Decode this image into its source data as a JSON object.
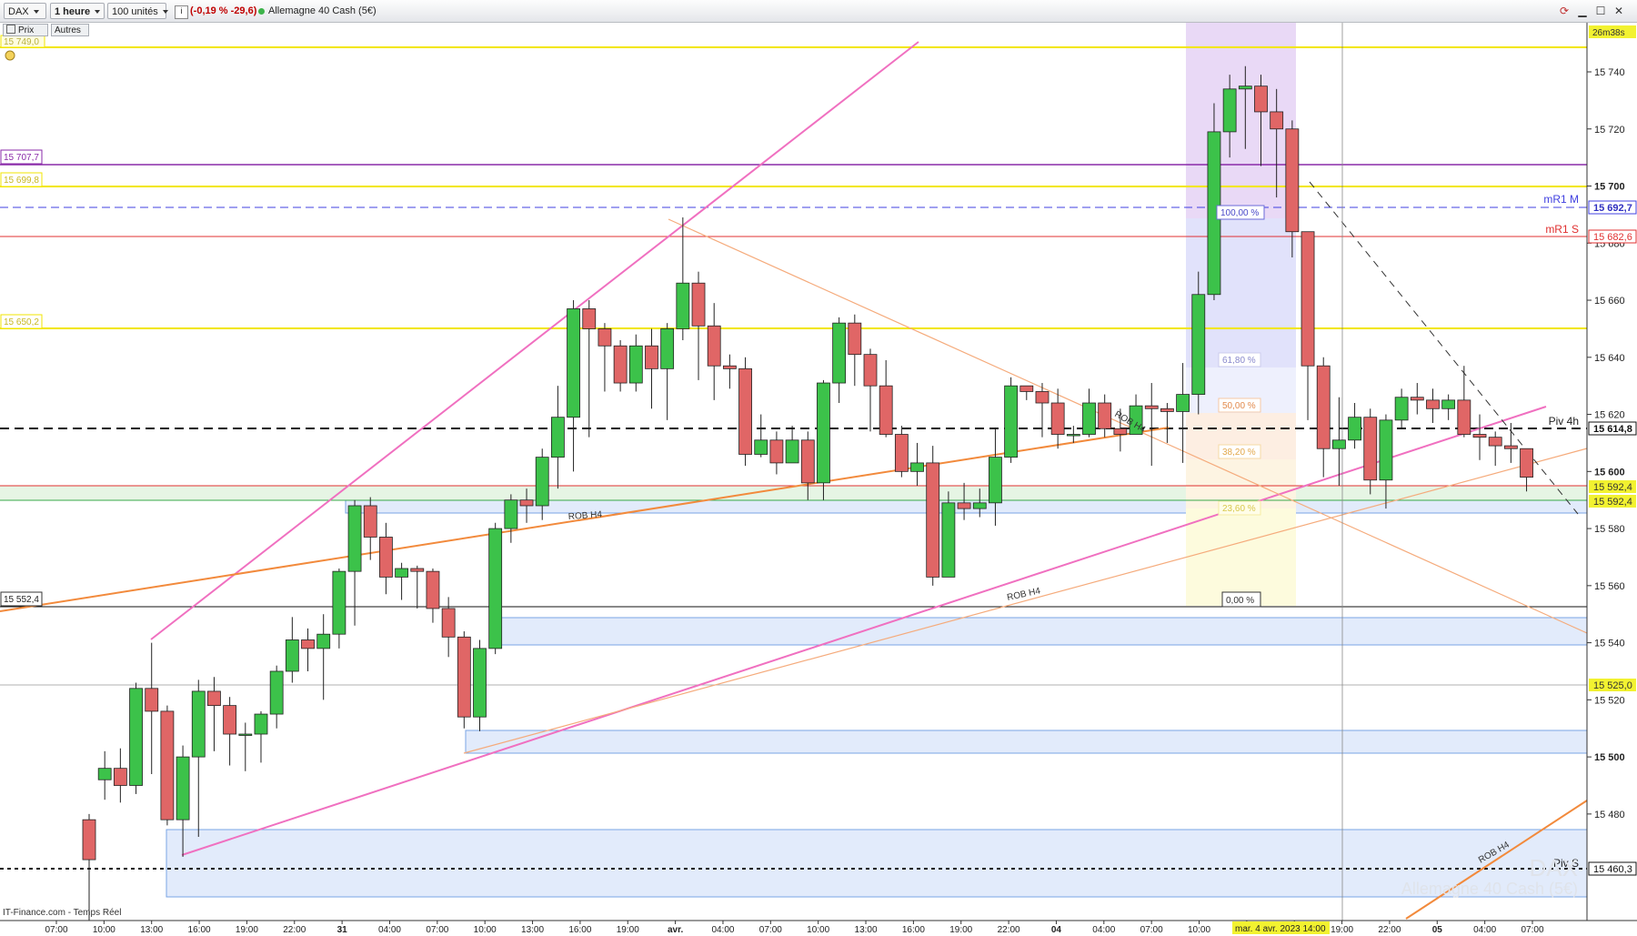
{
  "toolbar": {
    "symbol": "DAX",
    "timeframe": "1 heure",
    "units": "100 unités",
    "change": "(-0,19 % -29,6)",
    "instrument": "Allemagne 40 Cash (5€)"
  },
  "subbar": {
    "price_label": "Prix",
    "others_label": "Autres"
  },
  "timer": "26m38s",
  "footer": {
    "source": "IT-Finance.com - Temps Réel",
    "watermark_symbol": "DAX",
    "watermark_name": "Allemagne 40 Cash (5€)"
  },
  "colors": {
    "up": "#3cc24a",
    "down": "#e06666",
    "yellow": "#f2e600",
    "purple": "#8a2aa8",
    "blue_dash": "#4040e0",
    "red": "#e03030",
    "pink": "#f070c0",
    "orange": "#f28a3c",
    "zone_blue": "#e2ebfb"
  },
  "left_labels": {
    "l1": "15 749,0",
    "l2": "15 707,7",
    "l3": "15 699,8",
    "l4": "15 650,2",
    "l5": "15 552,4"
  },
  "right_labels": {
    "r1": "15 692,7",
    "r2": "15 682,6",
    "r3": "15 614,8",
    "r4": "15 592,4",
    "r5": "15 592,4",
    "r6": "15 525,0",
    "r7": "15 460,3"
  },
  "line_names": {
    "mr1m": "mR1 M",
    "mr1s": "mR1 S",
    "piv4h": "Piv 4h",
    "pivs": "Piv S"
  },
  "fib": {
    "f100": "100,00 %",
    "f618": "61,80 %",
    "f50": "50,00 %",
    "f382": "38,20 %",
    "f236": "23,60 %",
    "f0": "0,00 %"
  },
  "rob": {
    "a": "ROB H4",
    "b": "ROB H4",
    "c": "ROB H4",
    "d": "ROB H4"
  },
  "crosshair_label": "mar. 4 avr. 2023 14:00",
  "chart_data": {
    "type": "candlestick",
    "y_ticks": [
      "15 740",
      "15 720",
      "15 700",
      "15 680",
      "15 660",
      "15 640",
      "15 620",
      "15 600",
      "15 580",
      "15 560",
      "15 540",
      "15 520",
      "15 500",
      "15 480"
    ],
    "x_ticks": [
      "07:00",
      "10:00",
      "13:00",
      "16:00",
      "19:00",
      "22:00",
      "31",
      "04:00",
      "07:00",
      "10:00",
      "13:00",
      "16:00",
      "19:00",
      "avr.",
      "04:00",
      "07:00",
      "10:00",
      "13:00",
      "16:00",
      "19:00",
      "22:00",
      "04",
      "04:00",
      "07:00",
      "10:00",
      "13:00",
      "16:00",
      "19:00",
      "22:00",
      "05",
      "04:00",
      "07:00"
    ],
    "ylim": [
      15450,
      15760
    ],
    "candles": [
      [
        15478,
        15464,
        15480,
        15442
      ],
      [
        15492,
        15496,
        15502,
        15485
      ],
      [
        15496,
        15490,
        15503,
        15484
      ],
      [
        15490,
        15524,
        15526,
        15487
      ],
      [
        15524,
        15516,
        15540,
        15494
      ],
      [
        15516,
        15478,
        15518,
        15476
      ],
      [
        15478,
        15500,
        15504,
        15465
      ],
      [
        15500,
        15523,
        15527,
        15472
      ],
      [
        15523,
        15518,
        15528,
        15502
      ],
      [
        15518,
        15508,
        15521,
        15497
      ],
      [
        15508,
        15508,
        15512,
        15495
      ],
      [
        15508,
        15515,
        15516,
        15498
      ],
      [
        15515,
        15530,
        15532,
        15510
      ],
      [
        15530,
        15541,
        15549,
        15526
      ],
      [
        15541,
        15538,
        15545,
        15530
      ],
      [
        15538,
        15543,
        15550,
        15520
      ],
      [
        15543,
        15565,
        15566,
        15538
      ],
      [
        15565,
        15588,
        15590,
        15546
      ],
      [
        15588,
        15577,
        15591,
        15569
      ],
      [
        15577,
        15563,
        15582,
        15557
      ],
      [
        15563,
        15566,
        15568,
        15555
      ],
      [
        15566,
        15565,
        15567,
        15552
      ],
      [
        15565,
        15552,
        15566,
        15547
      ],
      [
        15552,
        15542,
        15556,
        15535
      ],
      [
        15542,
        15514,
        15544,
        15510
      ],
      [
        15514,
        15538,
        15541,
        15509
      ],
      [
        15538,
        15580,
        15582,
        15536
      ],
      [
        15580,
        15590,
        15592,
        15575
      ],
      [
        15590,
        15588,
        15594,
        15582
      ],
      [
        15588,
        15605,
        15608,
        15583
      ],
      [
        15605,
        15619,
        15630,
        15594
      ],
      [
        15619,
        15657,
        15660,
        15600
      ],
      [
        15657,
        15650,
        15660,
        15612
      ],
      [
        15650,
        15644,
        15652,
        15628
      ],
      [
        15644,
        15631,
        15646,
        15628
      ],
      [
        15631,
        15644,
        15648,
        15628
      ],
      [
        15644,
        15636,
        15650,
        15622
      ],
      [
        15636,
        15650,
        15652,
        15618
      ],
      [
        15650,
        15666,
        15689,
        15646
      ],
      [
        15666,
        15651,
        15670,
        15632
      ],
      [
        15651,
        15637,
        15659,
        15625
      ],
      [
        15637,
        15636,
        15641,
        15629
      ],
      [
        15636,
        15606,
        15640,
        15602
      ],
      [
        15606,
        15611,
        15620,
        15605
      ],
      [
        15611,
        15603,
        15614,
        15599
      ],
      [
        15603,
        15611,
        15616,
        15603
      ],
      [
        15611,
        15596,
        15614,
        15590
      ],
      [
        15596,
        15631,
        15632,
        15590
      ],
      [
        15631,
        15652,
        15654,
        15624
      ],
      [
        15652,
        15641,
        15655,
        15630
      ],
      [
        15641,
        15630,
        15643,
        15614
      ],
      [
        15630,
        15613,
        15639,
        15612
      ],
      [
        15613,
        15600,
        15616,
        15598
      ],
      [
        15600,
        15603,
        15610,
        15595
      ],
      [
        15603,
        15563,
        15609,
        15560
      ],
      [
        15563,
        15589,
        15593,
        15563
      ],
      [
        15589,
        15587,
        15596,
        15583
      ],
      [
        15587,
        15589,
        15594,
        15584
      ],
      [
        15589,
        15605,
        15615,
        15581
      ],
      [
        15605,
        15630,
        15633,
        15603
      ],
      [
        15630,
        15628,
        15630,
        15625
      ],
      [
        15628,
        15624,
        15631,
        15612
      ],
      [
        15624,
        15613,
        15629,
        15608
      ],
      [
        15613,
        15613,
        15616,
        15610
      ],
      [
        15613,
        15624,
        15629,
        15612
      ],
      [
        15624,
        15615,
        15627,
        15612
      ],
      [
        15615,
        15613,
        15622,
        15607
      ],
      [
        15613,
        15623,
        15627,
        15614
      ],
      [
        15623,
        15622,
        15631,
        15602
      ],
      [
        15622,
        15621,
        15624,
        15610
      ],
      [
        15621,
        15627,
        15638,
        15603
      ],
      [
        15627,
        15662,
        15670,
        15620
      ],
      [
        15662,
        15719,
        15729,
        15660
      ],
      [
        15719,
        15734,
        15739,
        15710
      ],
      [
        15734,
        15735,
        15742,
        15713
      ],
      [
        15735,
        15726,
        15739,
        15707
      ],
      [
        15726,
        15720,
        15734,
        15696
      ],
      [
        15720,
        15684,
        15723,
        15675
      ],
      [
        15684,
        15637,
        15683,
        15618
      ],
      [
        15637,
        15608,
        15640,
        15598
      ],
      [
        15608,
        15611,
        15626,
        15595
      ],
      [
        15611,
        15619,
        15624,
        15608
      ],
      [
        15619,
        15597,
        15622,
        15592
      ],
      [
        15597,
        15618,
        15620,
        15587
      ],
      [
        15618,
        15626,
        15629,
        15615
      ],
      [
        15626,
        15625,
        15631,
        15620
      ],
      [
        15625,
        15622,
        15629,
        15617
      ],
      [
        15622,
        15625,
        15627,
        15618
      ],
      [
        15625,
        15613,
        15637,
        15612
      ],
      [
        15613,
        15612,
        15620,
        15604
      ],
      [
        15612,
        15609,
        15614,
        15602
      ],
      [
        15609,
        15608,
        15617,
        15603
      ],
      [
        15608,
        15598,
        15604,
        15593
      ]
    ]
  }
}
